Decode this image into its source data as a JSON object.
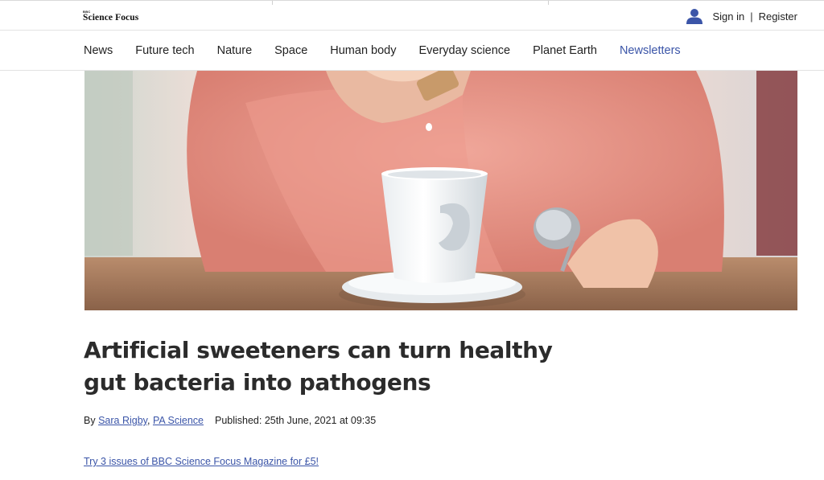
{
  "header": {
    "logo_small": "BBC",
    "logo_name": "Science Focus",
    "sign_in": "Sign in",
    "separator": "|",
    "register": "Register"
  },
  "nav": {
    "items": [
      "News",
      "Future tech",
      "Nature",
      "Space",
      "Human body",
      "Everyday science",
      "Planet Earth",
      "Newsletters"
    ]
  },
  "hero": {
    "description": "Hand dropping sweetener tablet into a white coffee cup"
  },
  "article": {
    "headline": "Artificial sweeteners can turn healthy gut bacteria into pathogens",
    "by_label": "By",
    "author_1": "Sara Rigby",
    "comma": ",",
    "author_2": "PA Science",
    "published": "Published: 25th June, 2021 at 09:35",
    "promo": "Try 3 issues of BBC Science Focus Magazine for £5!"
  },
  "colors": {
    "accent": "#3b55a8",
    "headline": "#2b2b2b"
  }
}
